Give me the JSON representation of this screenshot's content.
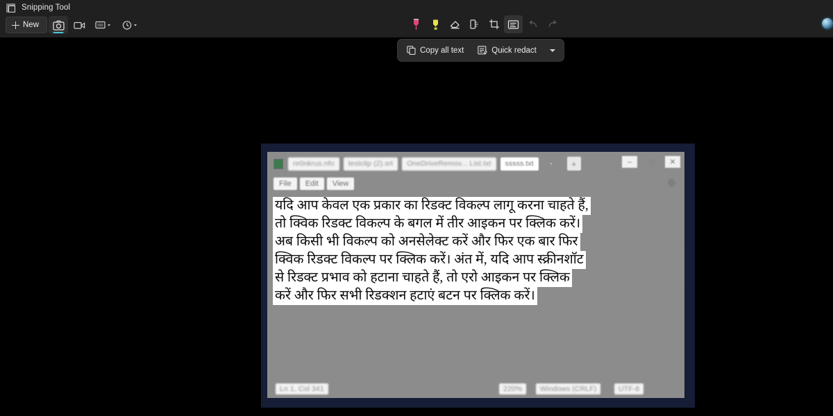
{
  "app": {
    "title": "Snipping Tool",
    "icon": "snipping-tool-icon",
    "new_button": {
      "label": "New",
      "icon": "plus-icon"
    },
    "capture_modes": [
      {
        "name": "screenshot-mode",
        "icon": "camera-icon",
        "active": true,
        "has_chevron": false
      },
      {
        "name": "video-mode",
        "icon": "video-camera-icon",
        "active": false,
        "has_chevron": false
      },
      {
        "name": "snip-shape-mode",
        "icon": "rectangle-icon",
        "active": false,
        "has_chevron": true
      },
      {
        "name": "delay-timer-mode",
        "icon": "timer-icon",
        "active": false,
        "has_chevron": true
      }
    ],
    "edit_tools": [
      {
        "name": "ballpoint-pen-tool",
        "icon": "pen-icon",
        "color": "#e0447a",
        "selected": false
      },
      {
        "name": "highlighter-tool",
        "icon": "highlighter-icon",
        "color": "#e8e24a",
        "selected": false
      },
      {
        "name": "eraser-tool",
        "icon": "eraser-icon",
        "color": "#d8d8d8",
        "selected": false
      },
      {
        "name": "ruler-tool",
        "icon": "ruler-protractor-icon",
        "color": "#d8d8d8",
        "selected": false
      },
      {
        "name": "crop-tool",
        "icon": "crop-icon",
        "color": "#d8d8d8",
        "selected": false
      },
      {
        "name": "text-actions-tool",
        "icon": "text-actions-icon",
        "color": "#e2e2e2",
        "selected": true
      },
      {
        "name": "undo-button",
        "icon": "undo-arrow-icon",
        "color": "#8a8a8a",
        "selected": false
      },
      {
        "name": "redo-button",
        "icon": "redo-arrow-icon",
        "color": "#8a8a8a",
        "selected": false
      }
    ],
    "action_bar": {
      "copy_all_text": {
        "label": "Copy all text",
        "icon": "copy-icon"
      },
      "quick_redact": {
        "label": "Quick redact",
        "icon": "redact-list-icon"
      },
      "dropdown_icon": "chevron-down-icon"
    },
    "accent_color": "#4cc2d6",
    "chrome_color": "#202020"
  },
  "capture": {
    "notepad": {
      "document_icon": "notepad-file-icon",
      "tabs": [
        {
          "label": "re0nkrus.nfo",
          "active": false
        },
        {
          "label": "testclip (2).srt",
          "active": false
        },
        {
          "label": "OneDriveRemov... List.txt",
          "active": false
        },
        {
          "label": "sssss.txt",
          "active": true
        }
      ],
      "tab_list_icon": "chevron-down-icon",
      "new_tab_label": "+",
      "window_controls": [
        {
          "name": "minimize-button",
          "glyph": "–"
        },
        {
          "name": "maximize-button",
          "glyph": "□"
        },
        {
          "name": "close-button",
          "glyph": "✕"
        }
      ],
      "menus": [
        "File",
        "Edit",
        "View"
      ],
      "settings_icon": "gear-icon",
      "text_lines": [
        "यदि आप केवल एक प्रकार का रिडक्ट विकल्प लागू करना चाहते हैं,",
        "तो क्विक रिडक्ट विकल्प के बगल में तीर आइकन पर क्लिक करें।",
        "अब किसी भी विकल्प को अनसेलेक्ट करें और फिर एक बार फिर",
        "क्विक रिडक्ट विकल्प पर क्लिक करें। अंत में,  यदि आप स्क्रीनशॉट",
        "से रिडक्ट प्रभाव को हटाना चाहते हैं,  तो एरो आइकन पर क्लिक",
        "करें और फिर सभी रिडक्शन हटाएं बटन पर क्लिक करें।"
      ],
      "status_bar": {
        "cursor_position": "Ln 1, Col 341",
        "zoom": "220%",
        "line_ending": "Windows (CRLF)",
        "encoding": "UTF-8"
      }
    }
  }
}
